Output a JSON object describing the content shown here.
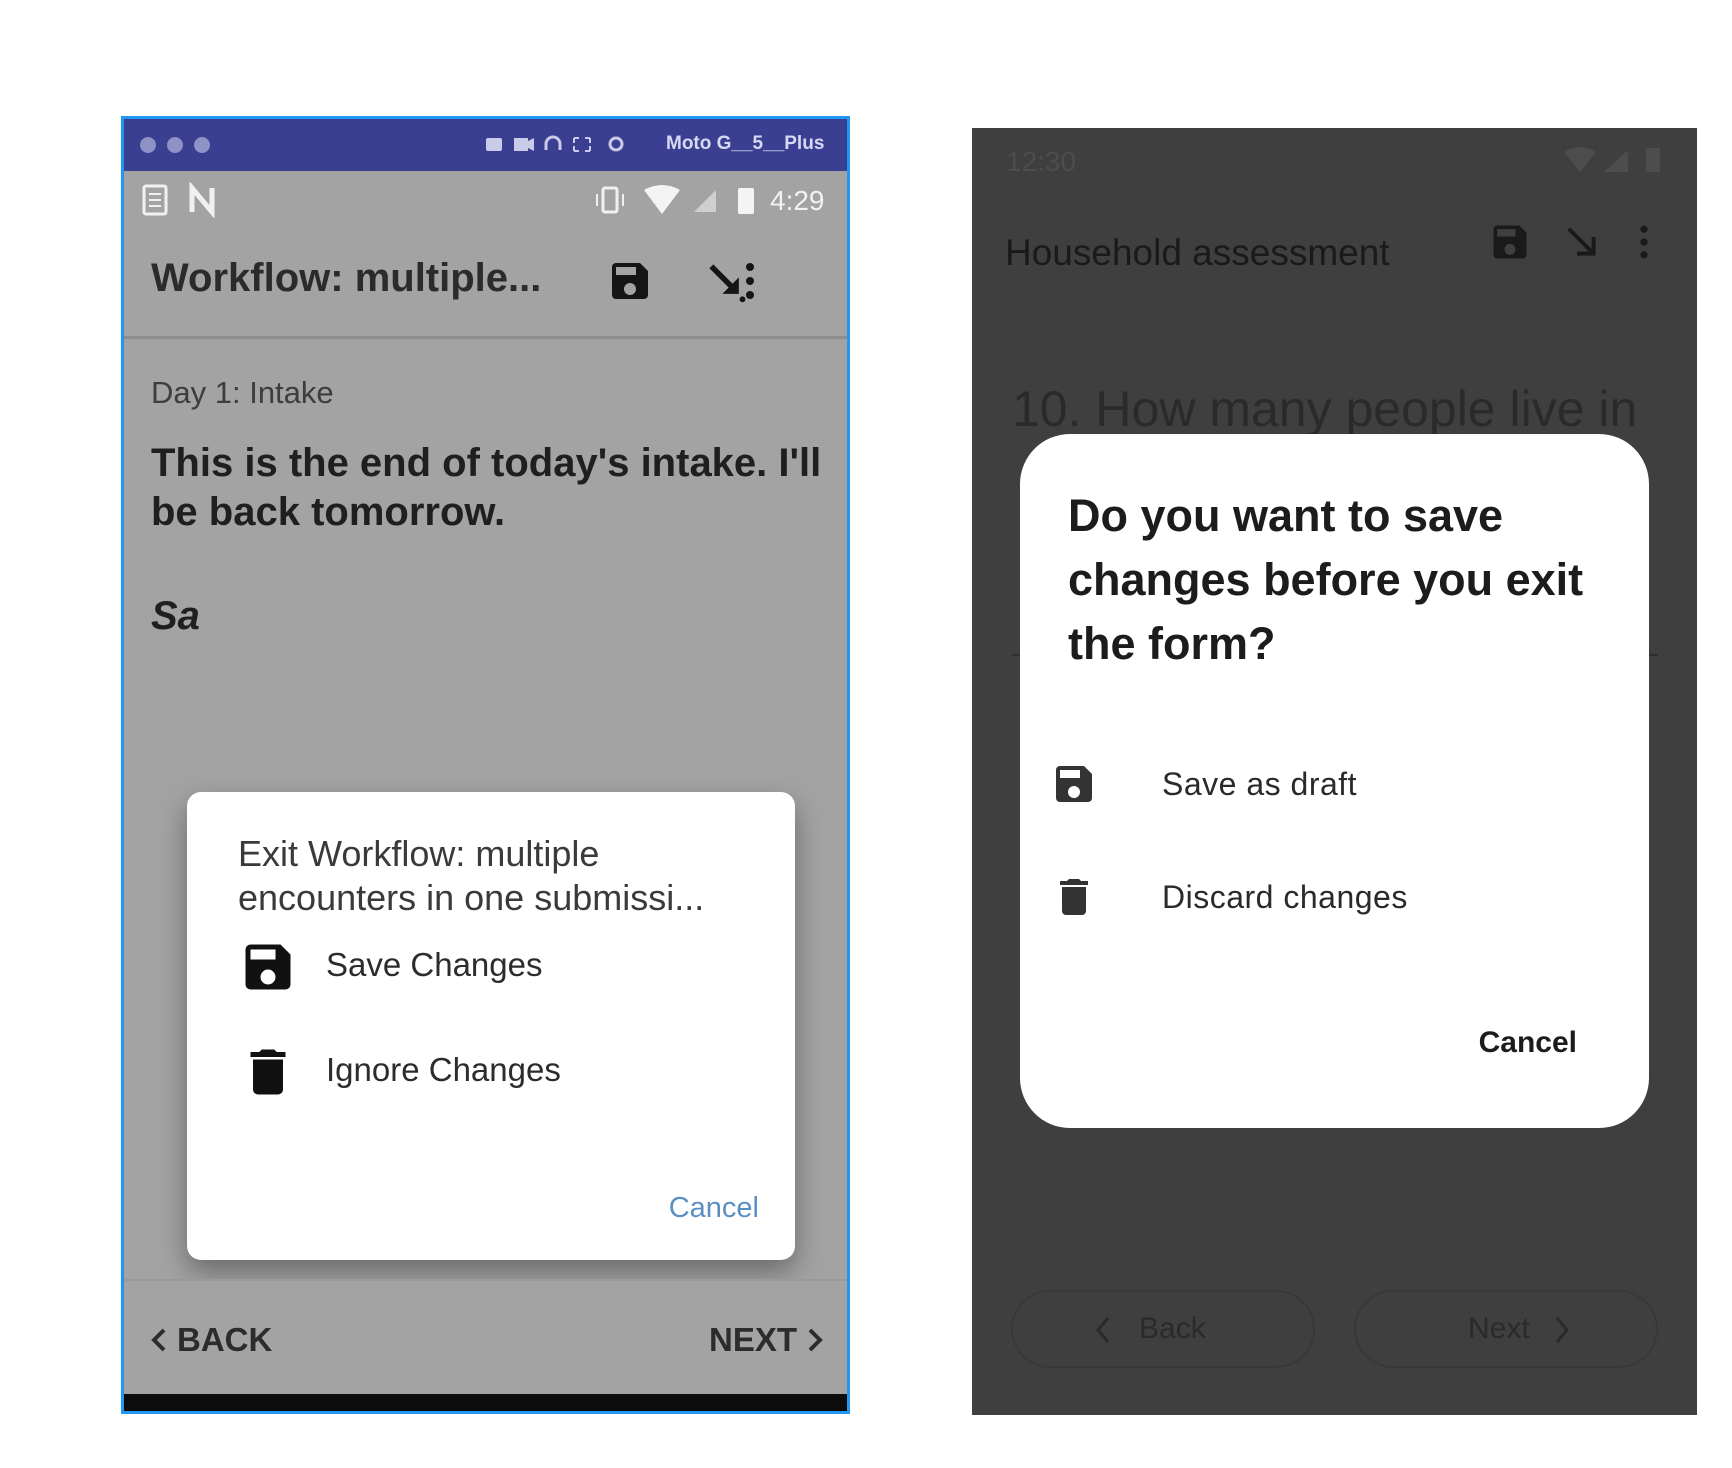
{
  "left_phone": {
    "emulator_bar": {
      "device_name": "Moto G__5__Plus"
    },
    "status_bar": {
      "time": "4:29"
    },
    "toolbar": {
      "title": "Workflow: multiple..."
    },
    "content": {
      "subtitle": "Day 1: Intake",
      "question": "This is the end of today's intake. I'll be back tomorrow.",
      "partial_text": "Sa"
    },
    "dialog": {
      "title": "Exit Workflow: multiple encounters in one submissi...",
      "options": [
        {
          "icon": "save-icon",
          "label": "Save Changes"
        },
        {
          "icon": "trash-icon",
          "label": "Ignore Changes"
        }
      ],
      "cancel_label": "Cancel"
    },
    "nav": {
      "back_label": "BACK",
      "next_label": "NEXT"
    }
  },
  "right_phone": {
    "status_bar": {
      "time": "12:30"
    },
    "toolbar": {
      "title": "Household assessment"
    },
    "content": {
      "question": "10. How many people live in"
    },
    "dialog": {
      "title": "Do you want to save changes before you exit the form?",
      "options": [
        {
          "icon": "save-icon",
          "label": "Save as draft"
        },
        {
          "icon": "trash-icon",
          "label": "Discard changes"
        }
      ],
      "cancel_label": "Cancel"
    },
    "nav": {
      "back_label": "Back",
      "next_label": "Next"
    }
  },
  "colors": {
    "left_frame_border": "#2196f3",
    "left_emulator_bar": "#3a3f92",
    "left_cancel_text": "#5b8fc4",
    "right_scrim": "#3f3f3f",
    "dialog_background": "#ffffff"
  }
}
